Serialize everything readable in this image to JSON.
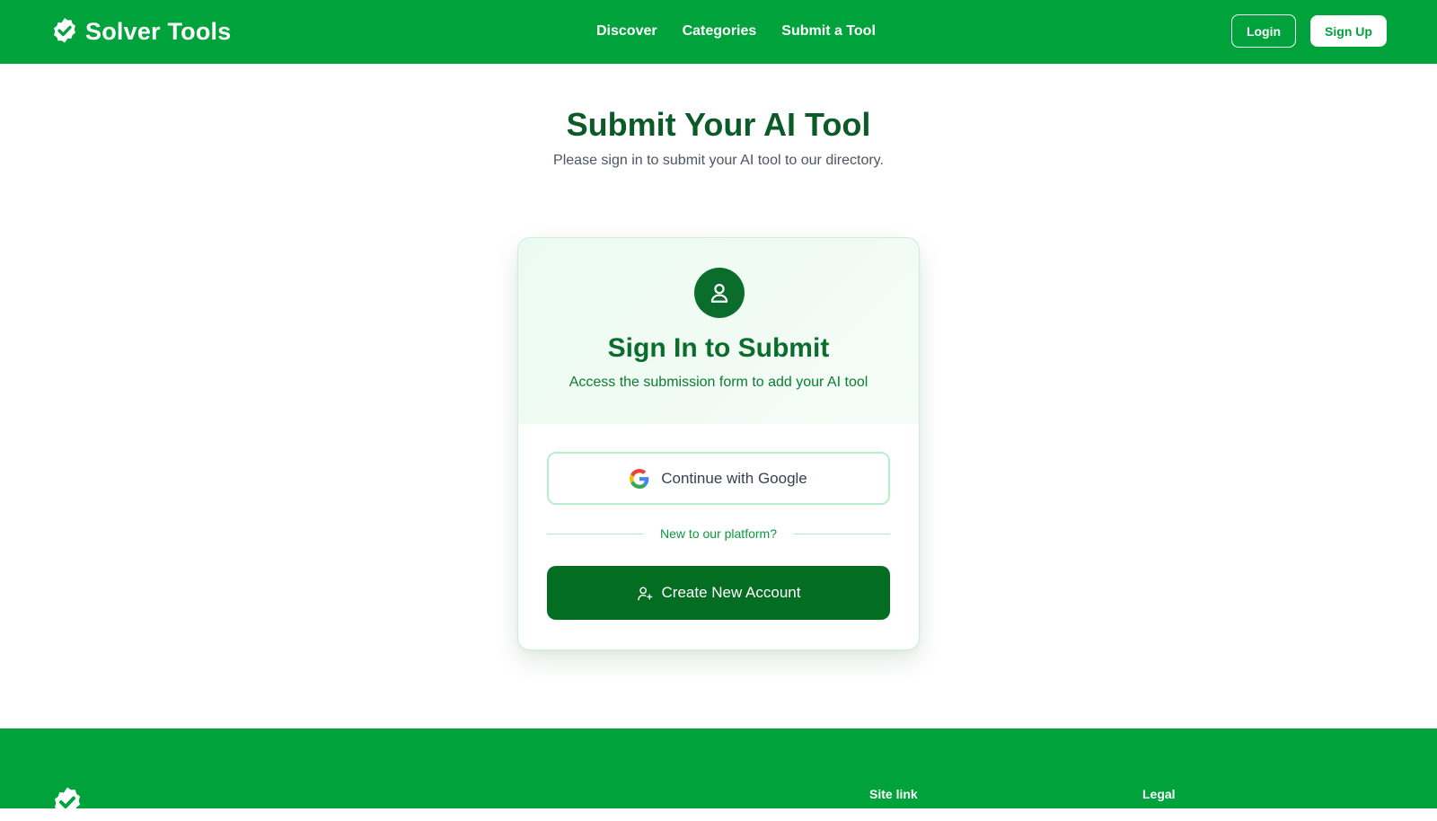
{
  "header": {
    "brand": "Solver Tools",
    "nav": [
      {
        "label": "Discover"
      },
      {
        "label": "Categories"
      },
      {
        "label": "Submit a Tool"
      }
    ],
    "login_label": "Login",
    "signup_label": "Sign Up"
  },
  "page": {
    "title": "Submit Your AI Tool",
    "subtitle": "Please sign in to submit your AI tool to our directory."
  },
  "card": {
    "title": "Sign In to Submit",
    "subtitle": "Access the submission form to add your AI tool",
    "google_label": "Continue with Google",
    "divider_text": "New to our platform?",
    "create_label": "Create New Account"
  },
  "footer": {
    "headings": [
      "Site link",
      "Legal"
    ]
  },
  "colors": {
    "brand_green": "#00a33b",
    "dark_green": "#036d22",
    "title_green": "#0b5a28"
  },
  "icons": {
    "brand": "badge-check-icon",
    "avatar": "user-icon",
    "google": "google-g-icon",
    "create": "user-plus-icon"
  }
}
